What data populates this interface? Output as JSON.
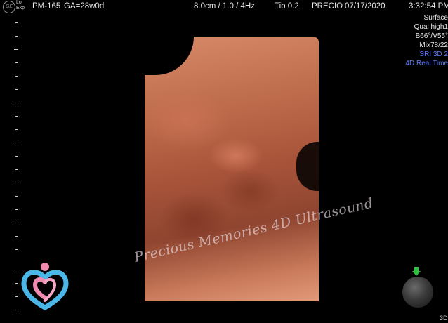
{
  "header": {
    "patient_id": "PM-165",
    "gestational_age": "GA=28w0d",
    "scan_params": "8.0cm / 1.0 / 4Hz",
    "tib": "Tib  0.2",
    "preset": "PRECIO",
    "date": "07/17/2020",
    "time": "3:32:54 PM",
    "logo_text": "GE",
    "exp_line1": "Lo",
    "exp_line2": "Exp"
  },
  "render_info": {
    "lines": [
      "Surface",
      "Qual high1",
      "B66°/V55°",
      "Mix78/22"
    ],
    "blue_lines": [
      "SRI 3D 2",
      "4D Real Time"
    ]
  },
  "watermark": "Precious Memories 4D Ultrasound",
  "footer": {
    "mode_label": "3D"
  },
  "colors": {
    "background": "#000000",
    "accent_blue": "#5b7bff",
    "gizmo_arrow": "#2fbf3f"
  }
}
